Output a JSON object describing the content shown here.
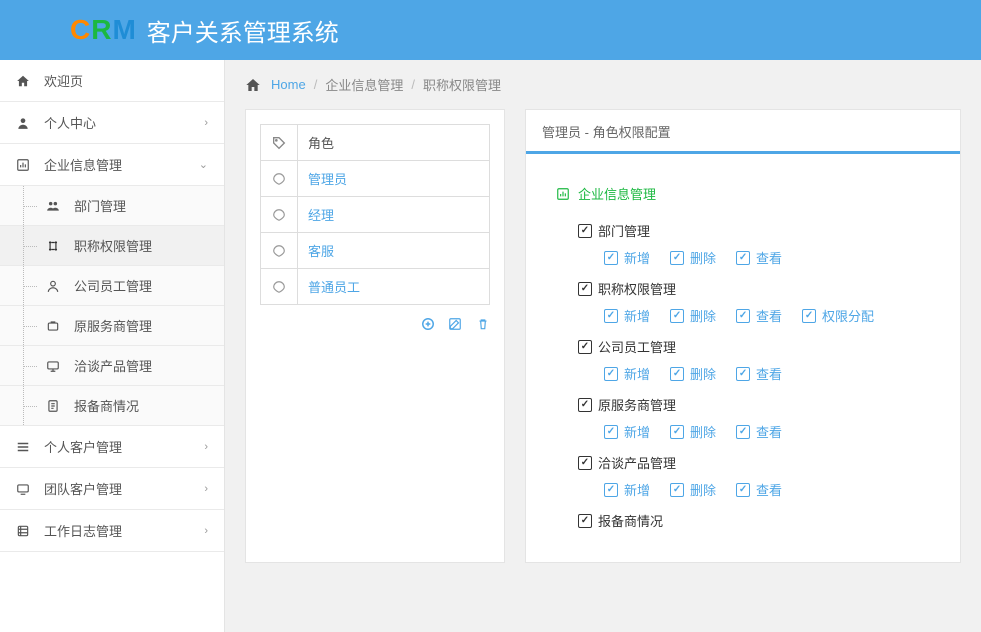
{
  "header": {
    "logo_c": "C",
    "logo_r": "R",
    "logo_m": "M",
    "title": "客户关系管理系统"
  },
  "breadcrumb": {
    "home": "Home",
    "level1": "企业信息管理",
    "level2": "职称权限管理"
  },
  "sidebar": {
    "items": [
      {
        "label": "欢迎页",
        "expandable": false
      },
      {
        "label": "个人中心",
        "expandable": true
      },
      {
        "label": "企业信息管理",
        "expandable": true,
        "expanded": true,
        "children": [
          {
            "label": "部门管理"
          },
          {
            "label": "职称权限管理",
            "active": true
          },
          {
            "label": "公司员工管理"
          },
          {
            "label": "原服务商管理"
          },
          {
            "label": "洽谈产品管理"
          },
          {
            "label": "报备商情况"
          }
        ]
      },
      {
        "label": "个人客户管理",
        "expandable": true
      },
      {
        "label": "团队客户管理",
        "expandable": true
      },
      {
        "label": "工作日志管理",
        "expandable": true
      }
    ]
  },
  "roles": {
    "header": "角色",
    "list": [
      {
        "name": "管理员"
      },
      {
        "name": "经理"
      },
      {
        "name": "客服"
      },
      {
        "name": "普通员工"
      }
    ]
  },
  "permissions": {
    "title_prefix": "管理员",
    "title_suffix": " - 角色权限配置",
    "group_title": "企业信息管理",
    "modules": [
      {
        "name": "部门管理",
        "checked": true,
        "actions": [
          {
            "label": "新增",
            "checked": true
          },
          {
            "label": "删除",
            "checked": true
          },
          {
            "label": "查看",
            "checked": true
          }
        ]
      },
      {
        "name": "职称权限管理",
        "checked": true,
        "actions": [
          {
            "label": "新增",
            "checked": true
          },
          {
            "label": "删除",
            "checked": true
          },
          {
            "label": "查看",
            "checked": true
          },
          {
            "label": "权限分配",
            "checked": true
          }
        ]
      },
      {
        "name": "公司员工管理",
        "checked": true,
        "actions": [
          {
            "label": "新增",
            "checked": true
          },
          {
            "label": "删除",
            "checked": true
          },
          {
            "label": "查看",
            "checked": true
          }
        ]
      },
      {
        "name": "原服务商管理",
        "checked": true,
        "actions": [
          {
            "label": "新增",
            "checked": true
          },
          {
            "label": "删除",
            "checked": true
          },
          {
            "label": "查看",
            "checked": true
          }
        ]
      },
      {
        "name": "洽谈产品管理",
        "checked": true,
        "actions": [
          {
            "label": "新增",
            "checked": true
          },
          {
            "label": "删除",
            "checked": true
          },
          {
            "label": "查看",
            "checked": true
          }
        ]
      },
      {
        "name": "报备商情况",
        "checked": true,
        "actions": []
      }
    ]
  }
}
